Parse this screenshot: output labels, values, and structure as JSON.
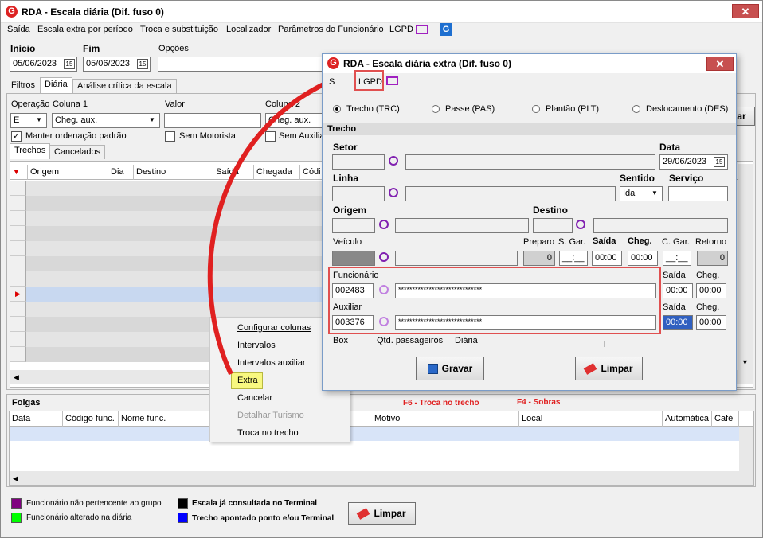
{
  "window": {
    "title": "RDA - Escala diária (Dif. fuso 0)",
    "close": "✕"
  },
  "menu": [
    "Saída",
    "Escala extra por período",
    "Troca e substituição",
    "Localizador",
    "Parâmetros do Funcionário",
    "LGPD"
  ],
  "filters": {
    "inicio_label": "Início",
    "inicio_value": "05/06/2023",
    "fim_label": "Fim",
    "fim_value": "05/06/2023",
    "opcoes_label": "Opções"
  },
  "tabs_top": [
    "Filtros",
    "Diária",
    "Análise crítica da escala"
  ],
  "operacao": {
    "operacao_label": "Operação",
    "coluna1_label": "Coluna 1",
    "valor_label": "Valor",
    "coluna2_label": "Coluna 2",
    "operacao_value": "E",
    "coluna1_value": "Cheg. aux.",
    "coluna2_value": "Cheg. aux.",
    "manter_label": "Manter ordenação padrão",
    "sem_motorista_label": "Sem Motorista",
    "sem_auxiliar_label": "Sem Auxiliar"
  },
  "tabs_grid": [
    "Trechos",
    "Cancelados"
  ],
  "grid_headers": [
    "Origem",
    "Dia",
    "Destino",
    "Saída",
    "Chegada",
    "Códi"
  ],
  "context_menu": [
    "Configurar colunas",
    "Intervalos",
    "Intervalos auxiliar",
    "Extra",
    "Cancelar",
    "Detalhar Turismo",
    "Troca no trecho"
  ],
  "folgas": {
    "label": "Folgas",
    "f6": "F6 - Troca no trecho",
    "f4": "F4 - Sobras",
    "headers": [
      "Data",
      "Código func.",
      "Nome func.",
      "Motivo",
      "Local",
      "Automática",
      "Café"
    ]
  },
  "legend": [
    {
      "color": "#800080",
      "text": "Funcionário não pertencente ao grupo"
    },
    {
      "color": "#00ff00",
      "text": "Funcionário alterado na diária"
    },
    {
      "color": "#000000",
      "text": "Escala já consultada no Terminal"
    },
    {
      "color": "#0000ff",
      "text": "Trecho apontado ponto e/ou Terminal"
    }
  ],
  "limpar_main": "Limpar",
  "right_btn_fragment": "ar",
  "dialog": {
    "title": "RDA - Escala diária extra (Dif. fuso 0)",
    "menu_saida": "S",
    "menu_lgpd": "LGPD",
    "radios": [
      "Trecho (TRC)",
      "Passe (PAS)",
      "Plantão (PLT)",
      "Deslocamento (DES)"
    ],
    "section": "Trecho",
    "setor_label": "Setor",
    "data_label": "Data",
    "data_value": "29/06/2023",
    "linha_label": "Linha",
    "sentido_label": "Sentido",
    "servico_label": "Serviço",
    "sentido_value": "Ida",
    "origem_label": "Origem",
    "destino_label": "Destino",
    "veiculo_label": "Veículo",
    "preparo_label": "Preparo",
    "sgar_label": "S. Gar.",
    "saida_label": "Saída",
    "cheg_label": "Cheg.",
    "cgar_label": "C. Gar.",
    "retorno_label": "Retorno",
    "preparo_value": "0",
    "sgar_value": "__:__",
    "saida_value": "00:00",
    "cheg_value": "00:00",
    "cgar_value": "__:__",
    "retorno_value": "0",
    "funcionario_label": "Funcionário",
    "funcionario_code": "002483",
    "funcionario_name": "******************************",
    "auxiliar_label": "Auxiliar",
    "auxiliar_code": "003376",
    "auxiliar_name": "******************************",
    "f_saida_label": "Saída",
    "f_cheg_label": "Cheg.",
    "f_saida": "00:00",
    "f_cheg": "00:00",
    "a_saida_label": "Saída",
    "a_cheg_label": "Cheg.",
    "a_saida": "00:00",
    "a_cheg": "00:00",
    "box_label": "Box",
    "qtd_label": "Qtd. passageiros",
    "diaria_label": "Diária",
    "gravar": "Gravar",
    "limpar": "Limpar",
    "close": "✕"
  }
}
